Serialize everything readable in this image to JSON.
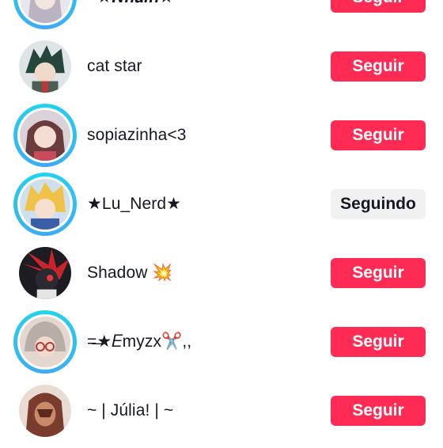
{
  "accounts": [
    {
      "username": "~★𝑵𝒉𝒂𝒊𝒏★~",
      "button": "Seguir",
      "state": "follow",
      "ring": true,
      "avatar": "anime-girl-avatar"
    },
    {
      "username": "cat star",
      "button": "Seguir",
      "state": "follow",
      "ring": false,
      "avatar": "green-hair-hero-avatar"
    },
    {
      "username": "sopiazinha<3",
      "button": "Seguir",
      "state": "follow",
      "ring": true,
      "avatar": "brown-hair-girl-avatar"
    },
    {
      "username": "★Lu_Nerd★",
      "button": "Seguindo",
      "state": "following",
      "ring": true,
      "avatar": "blonde-hero-avatar"
    },
    {
      "username": "Shadow 💥",
      "button": "Seguir",
      "state": "follow",
      "ring": false,
      "avatar": "shadow-hedgehog-avatar"
    },
    {
      "username": "=̶★𝐸myzx✂️,,",
      "button": "Seguir",
      "state": "follow",
      "ring": true,
      "avatar": "gray-hair-glasses-avatar"
    },
    {
      "username": "~ | Júlia! | ~",
      "button": "Seguir",
      "state": "follow",
      "ring": false,
      "avatar": "masked-character-avatar"
    }
  ],
  "colors": {
    "follow": "#fe2c55",
    "following": "#f1f1f2",
    "ring": "#20d5ec"
  }
}
